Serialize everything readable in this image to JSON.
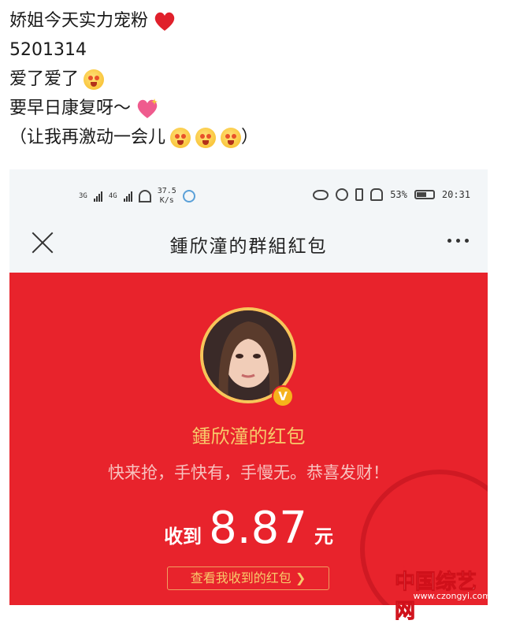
{
  "post": {
    "lines": [
      "娇姐今天实力宠粉",
      "5201314",
      "爱了爱了",
      "要早日康复呀～",
      "（让我再激动一会儿"
    ],
    "line_icons": [
      "heart-icon",
      "",
      "starstruck-face-icon",
      "sparkling-heart-icon",
      "excited-face-icon"
    ],
    "line5_close": "）"
  },
  "status_bar": {
    "network_1": "3G",
    "network_2": "4G",
    "net_speed_value": "37.5",
    "net_speed_unit": "K/s",
    "battery": "53%",
    "time": "20:31"
  },
  "nav": {
    "title": "鍾欣潼的群組紅包"
  },
  "red_packet": {
    "sender_label": "鍾欣潼的红包",
    "blessing": "快来抢，手快有，手慢无。恭喜发财！",
    "received_label": "收到",
    "amount": "8.87",
    "unit": "元",
    "view_link": "查看我收到的红包 ❯",
    "verified_badge": "V"
  },
  "watermark": {
    "name": "中国综艺网",
    "url": "www.czongyi.com"
  },
  "colors": {
    "packet_red": "#e8232c",
    "gold": "#f7c96a",
    "heart": "#e0202b"
  }
}
